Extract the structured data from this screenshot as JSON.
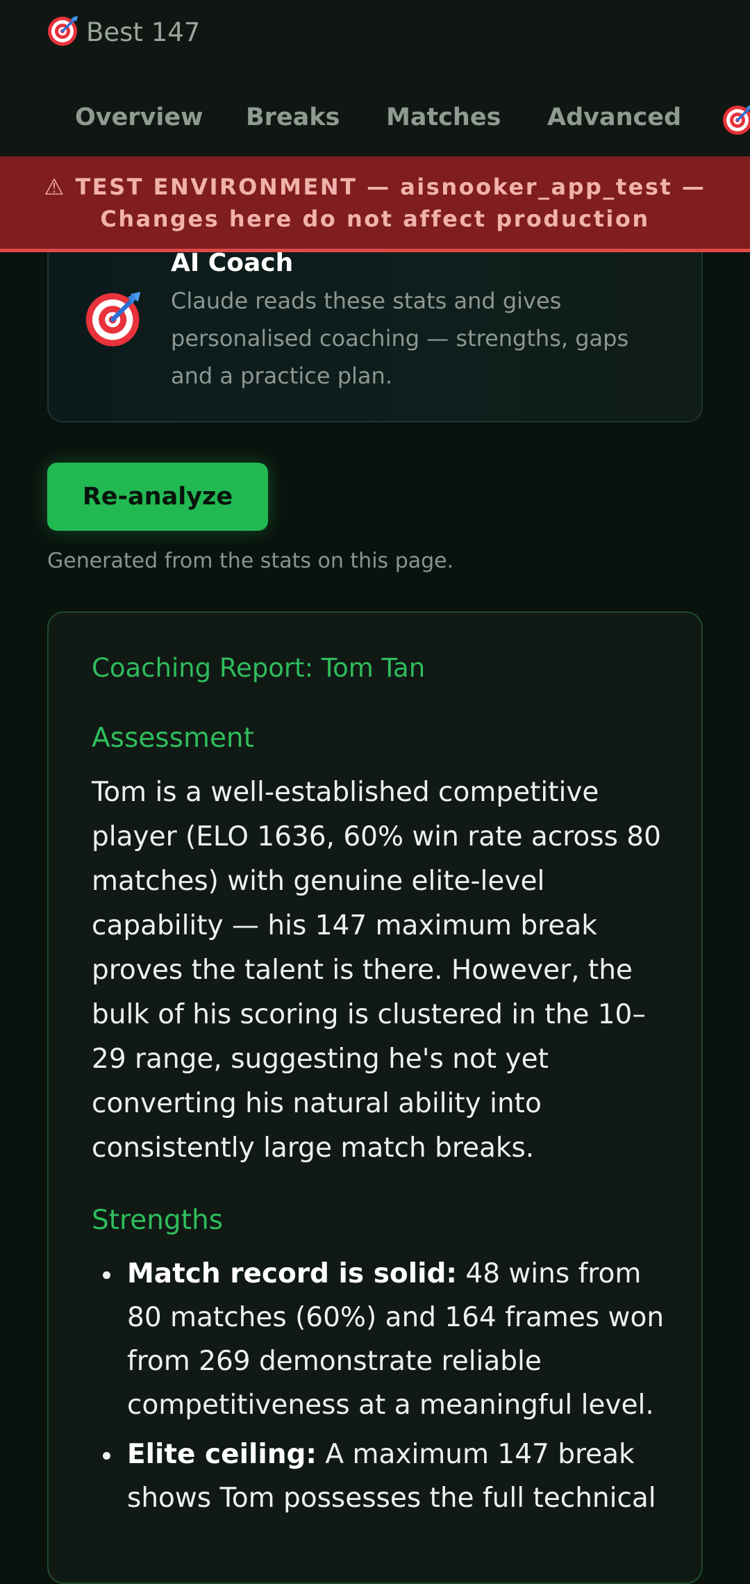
{
  "header": {
    "best_label": "Best 147",
    "best_icon": "target-dart-icon"
  },
  "tabs": [
    {
      "label": "Overview"
    },
    {
      "label": "Breaks"
    },
    {
      "label": "Matches"
    },
    {
      "label": "Advanced"
    }
  ],
  "banner": {
    "line1": "⚠ TEST ENVIRONMENT — aisnooker_app_test —",
    "line2": "Changes here do not affect production"
  },
  "coach": {
    "title": "AI Coach",
    "description": "Claude reads these stats and gives personalised coaching — strengths, gaps and a practice plan.",
    "icon": "target-dart-icon"
  },
  "actions": {
    "reanalyze_label": "Re-analyze",
    "generated_note": "Generated from the stats on this page."
  },
  "report": {
    "title": "Coaching Report: Tom Tan",
    "assessment_heading": "Assessment",
    "assessment_text": "Tom is a well-established competitive player (ELO 1636, 60% win rate across 80 matches) with genuine elite-level capability — his 147 maximum break proves the talent is there. However, the bulk of his scoring is clustered in the 10–29 range, suggesting he's not yet converting his natural ability into consistently large match breaks.",
    "strengths_heading": "Strengths",
    "strengths": [
      {
        "title": "Match record is solid:",
        "text": " 48 wins from 80 matches (60%) and 164 frames won from 269 demonstrate reliable competitiveness at a meaningful level."
      },
      {
        "title": "Elite ceiling:",
        "text": " A maximum 147 break shows Tom possesses the full technical"
      }
    ]
  },
  "colors": {
    "accent": "#22b953",
    "banner_bg": "#7f1d1f",
    "banner_border": "#e04848",
    "background": "#0a120e"
  }
}
